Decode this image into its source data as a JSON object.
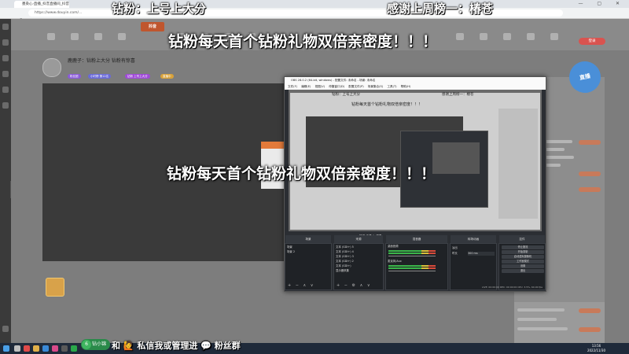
{
  "browser": {
    "tab_title": "墨染心·直播_抖音直播间_抖音",
    "url": "https://www.douyin.com/..."
  },
  "captions": {
    "top_left": "钻粉：上号上大分",
    "top_right": "感谢上周榜一：椿苍",
    "banner_line1": "钻粉每天首个钻粉礼物双倍亲密度！！！",
    "banner_line2": "钻粉每天首个钻粉礼物双倍亲密度！！！"
  },
  "site": {
    "logo": "抖音",
    "login_label": "登录",
    "room_title": "鹿鹿子：钻粉上大分 钻粉有惊喜",
    "tags": [
      {
        "label": "粉丝团",
        "color": "#8a5ad8"
      },
      {
        "label": "小时榜 第12名",
        "color": "#6a6ad8"
      },
      {
        "label": "钻粉 上号上大分",
        "color": "#a04ad8"
      },
      {
        "label": "直播中",
        "color": "#d8a23a"
      }
    ],
    "badge": "直播"
  },
  "obs": {
    "title": "OBS 28.0.2 (64-bit, windows) - 配置文件: 未命名 - 场景: 未命名",
    "menu": "文件(F) 编辑(E) 视图(V) 停靠窗口(D) 配置文件(P) 场景集合(S) 工具(T) 帮助(H)",
    "preview_caption_left": "钻粉：上号上大分",
    "preview_caption_right": "感谢上周榜一：椿苍",
    "preview_banner": "钻粉每天首个钻粉礼物双倍亲密度！！！",
    "tabs": "场景 来源 ⊕ 滤镜",
    "docks": {
      "scenes": {
        "title": "场景",
        "items": [
          "场景",
          "场景 2"
        ]
      },
      "sources": {
        "title": "来源",
        "items": [
          "文本 (GDI+) 5",
          "文本 (GDI+) 4",
          "文本 (GDI+) 3",
          "文本 (GDI+) 2",
          "文本 (GDI+)",
          "显示器采集"
        ]
      },
      "mixer": {
        "title": "混音器",
        "items": [
          "桌面音频",
          "麦克风/Aux"
        ]
      },
      "transitions": {
        "title": "转场动画",
        "items": [
          "淡出",
          "时长",
          "300 ms"
        ]
      },
      "controls": {
        "title": "控件",
        "items": [
          "停止推流",
          "开始录制",
          "启动虚拟摄像机",
          "工作室模式",
          "设置",
          "退出"
        ]
      }
    },
    "status": "LIVE: 00:00:00  REC: 00:00:00  CPU: 3.5%, 60.00 fps"
  },
  "taskbar": {
    "time": "13:56",
    "date": "2022/11/30"
  },
  "footer": {
    "pill_number": "6",
    "pill_label": "钻小锦",
    "text": "和 🙋 私信我或管理进 💬 粉丝群"
  }
}
